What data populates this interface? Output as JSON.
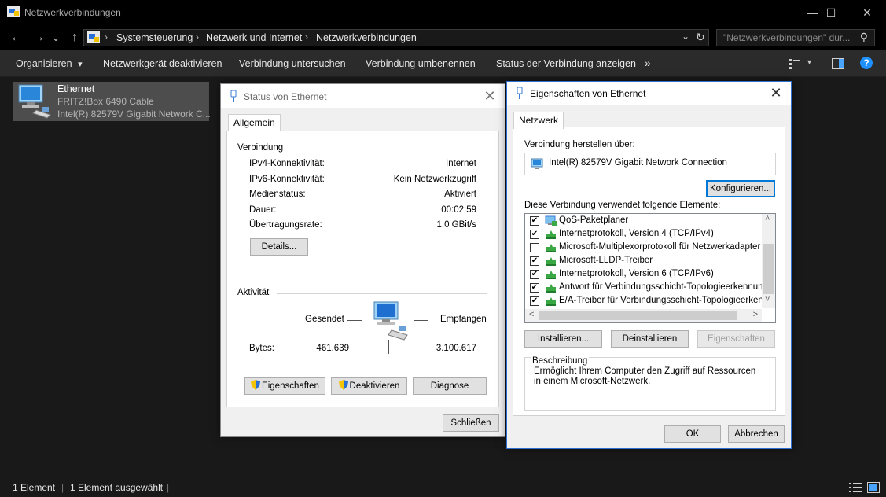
{
  "window": {
    "title": "Netzwerkverbindungen",
    "minimize": "—",
    "maximize": "☐",
    "close": "✕"
  },
  "nav": {
    "back": "←",
    "forward": "→",
    "recent": "⌄",
    "up": "↑"
  },
  "address": {
    "crumbs": [
      "Systemsteuerung",
      "Netzwerk und Internet",
      "Netzwerkverbindungen"
    ],
    "separator": "›",
    "dropdown": "⌄",
    "refresh": "↻"
  },
  "search": {
    "placeholder": "\"Netzwerkverbindungen\" dur...",
    "icon": "⚲"
  },
  "toolbar": {
    "organize": "Organisieren",
    "organize_arrow": "▾",
    "disable": "Netzwerkgerät deaktivieren",
    "diagnose": "Verbindung untersuchen",
    "rename": "Verbindung umbenennen",
    "status": "Status der Verbindung anzeigen",
    "more": "»",
    "help": "?"
  },
  "connection": {
    "name": "Ethernet",
    "network": "FRITZ!Box 6490 Cable",
    "adapter": "Intel(R) 82579V Gigabit Network C..."
  },
  "statusbar": {
    "count": "1 Element",
    "selected": "1 Element ausgewählt"
  },
  "status_dialog": {
    "title": "Status von Ethernet",
    "close": "✕",
    "tab": "Allgemein",
    "connection_group": "Verbindung",
    "rows": [
      {
        "label": "IPv4-Konnektivität:",
        "value": "Internet"
      },
      {
        "label": "IPv6-Konnektivität:",
        "value": "Kein Netzwerkzugriff"
      },
      {
        "label": "Medienstatus:",
        "value": "Aktiviert"
      },
      {
        "label": "Dauer:",
        "value": "00:02:59"
      },
      {
        "label": "Übertragungsrate:",
        "value": "1,0 GBit/s"
      }
    ],
    "details_button": "Details...",
    "activity_group": "Aktivität",
    "sent_label": "Gesendet",
    "received_label": "Empfangen",
    "bytes_label": "Bytes:",
    "bytes_sent": "461.639",
    "bytes_received": "3.100.617",
    "properties_button": "Eigenschaften",
    "disable_button": "Deaktivieren",
    "diagnose_button": "Diagnose",
    "close_button": "Schließen"
  },
  "props_dialog": {
    "title": "Eigenschaften von Ethernet",
    "close": "✕",
    "tab": "Netzwerk",
    "connect_using_label": "Verbindung herstellen über:",
    "adapter_name": "Intel(R) 82579V Gigabit Network Connection",
    "configure_button": "Konfigurieren...",
    "items_label": "Diese Verbindung verwendet folgende Elemente:",
    "items": [
      {
        "checked": true,
        "label": "QoS-Paketplaner"
      },
      {
        "checked": true,
        "label": "Internetprotokoll, Version 4 (TCP/IPv4)"
      },
      {
        "checked": false,
        "label": "Microsoft-Multiplexorprotokoll für Netzwerkadapter"
      },
      {
        "checked": true,
        "label": "Microsoft-LLDP-Treiber"
      },
      {
        "checked": true,
        "label": "Internetprotokoll, Version 6 (TCP/IPv6)"
      },
      {
        "checked": true,
        "label": "Antwort für Verbindungsschicht-Topologieerkennung"
      },
      {
        "checked": true,
        "label": "E/A-Treiber für Verbindungsschicht-Topologieerkennung"
      }
    ],
    "scroll_up": "˄",
    "scroll_down": "˅",
    "scroll_left": "<",
    "scroll_right": ">",
    "install_button": "Installieren...",
    "uninstall_button": "Deinstallieren",
    "properties_button": "Eigenschaften",
    "description_label": "Beschreibung",
    "description_text": "Ermöglicht Ihrem Computer den Zugriff auf Ressourcen in einem Microsoft-Netzwerk.",
    "ok_button": "OK",
    "cancel_button": "Abbrechen"
  },
  "colors": {
    "explorer_bg": "#191919",
    "selection": "#4d4d4d",
    "accent": "#0078d7",
    "help": "#1e90ff"
  }
}
